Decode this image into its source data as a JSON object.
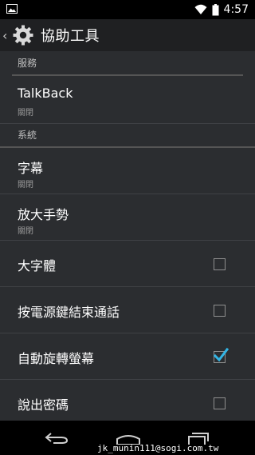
{
  "status": {
    "time": "4:57"
  },
  "header": {
    "title": "協助工具"
  },
  "sections": {
    "services": "服務",
    "system": "系統"
  },
  "items": {
    "talkback": {
      "label": "TalkBack",
      "sub": "關閉"
    },
    "captions": {
      "label": "字幕",
      "sub": "關閉"
    },
    "magnification": {
      "label": "放大手勢",
      "sub": "關閉"
    },
    "large_text": {
      "label": "大字體",
      "checked": false
    },
    "power_ends_call": {
      "label": "按電源鍵結束通話",
      "checked": false
    },
    "auto_rotate": {
      "label": "自動旋轉螢幕",
      "checked": true
    },
    "speak_passwords": {
      "label": "說出密碼",
      "checked": false
    }
  },
  "watermark": "jk_munin111@sogi.com.tw",
  "accent_color": "#33b5e5"
}
